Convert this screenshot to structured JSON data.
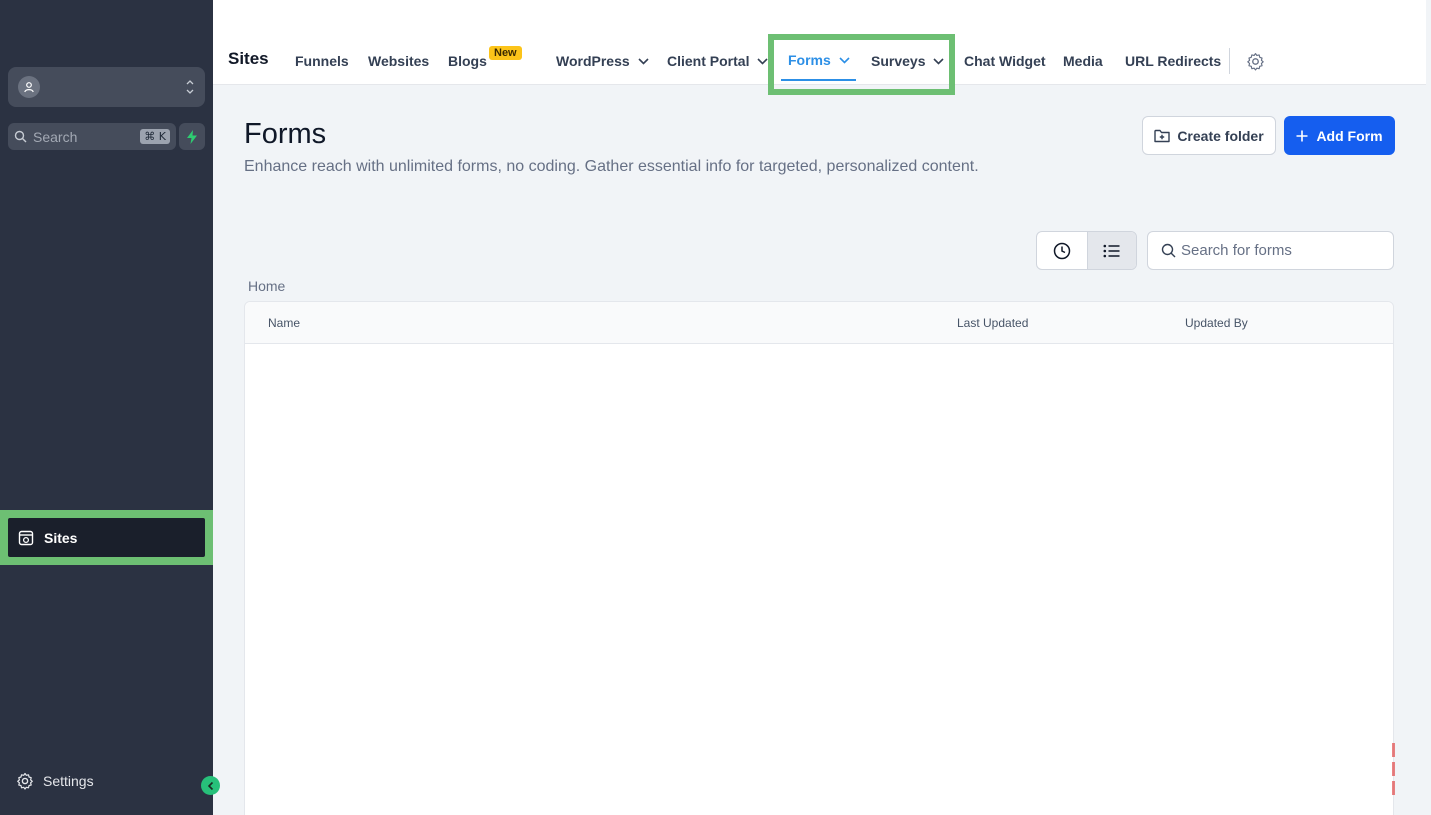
{
  "sidebar": {
    "search_label": "Search",
    "search_shortcut": "⌘ K",
    "active_item": {
      "label": "Sites",
      "icon": "sites-icon"
    },
    "settings_label": "Settings"
  },
  "topnav": {
    "title": "Sites",
    "items": [
      {
        "label": "Funnels"
      },
      {
        "label": "Websites"
      },
      {
        "label": "Blogs",
        "badge": "New"
      },
      {
        "label": "WordPress"
      },
      {
        "label": "Client Portal"
      },
      {
        "label": "Forms"
      },
      {
        "label": "Surveys"
      },
      {
        "label": "Chat Widget"
      },
      {
        "label": "Media"
      },
      {
        "label": "URL Redirects"
      }
    ],
    "active": "Forms"
  },
  "page": {
    "title": "Forms",
    "description": "Enhance reach with unlimited forms, no coding. Gather essential info for targeted, personalized content.",
    "create_folder_label": "Create folder",
    "add_form_label": "Add Form",
    "search_placeholder": "Search for forms",
    "breadcrumb": "Home"
  },
  "table": {
    "columns": [
      "Name",
      "Last Updated",
      "Updated By"
    ],
    "rows": []
  },
  "colors": {
    "sidebar_bg": "#2b3242",
    "accent_blue": "#155eef",
    "active_tab": "#2c8fe6",
    "highlight_green": "#6dbf73",
    "badge_yellow": "#fcc419"
  }
}
